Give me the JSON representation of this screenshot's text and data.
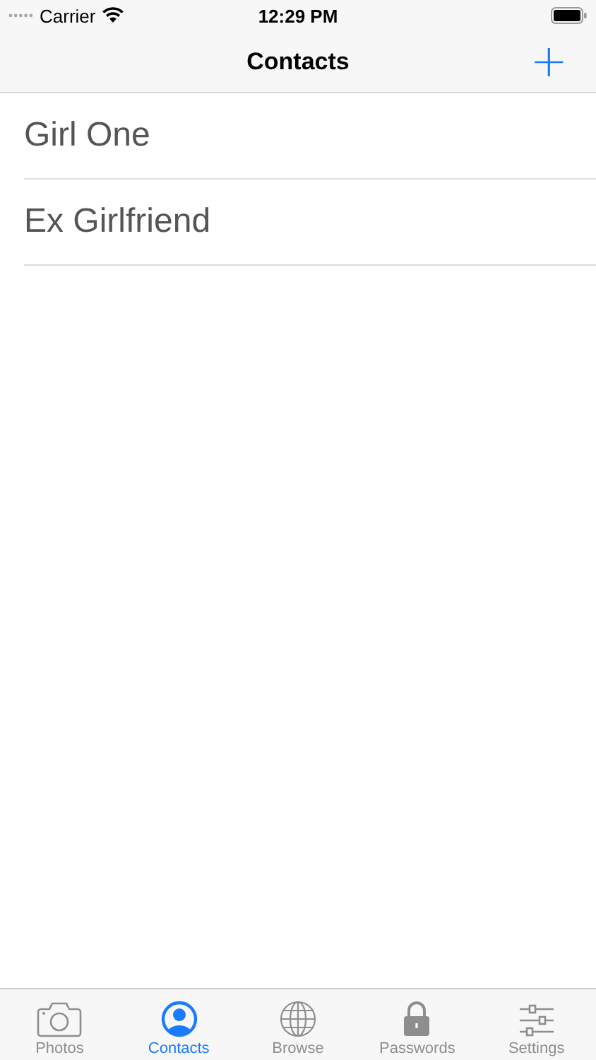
{
  "status_bar": {
    "carrier": "Carrier",
    "time": "12:29 PM"
  },
  "nav_bar": {
    "title": "Contacts",
    "add_button": "+"
  },
  "contacts": [
    {
      "name": "Girl One"
    },
    {
      "name": "Ex Girlfriend"
    }
  ],
  "tab_bar": [
    {
      "kind": "camera",
      "label": "Photos",
      "selected": false
    },
    {
      "kind": "person",
      "label": "Contacts",
      "selected": true
    },
    {
      "kind": "globe",
      "label": "Browse",
      "selected": false
    },
    {
      "kind": "lock",
      "label": "Passwords",
      "selected": false
    },
    {
      "kind": "sliders",
      "label": "Settings",
      "selected": false
    }
  ]
}
